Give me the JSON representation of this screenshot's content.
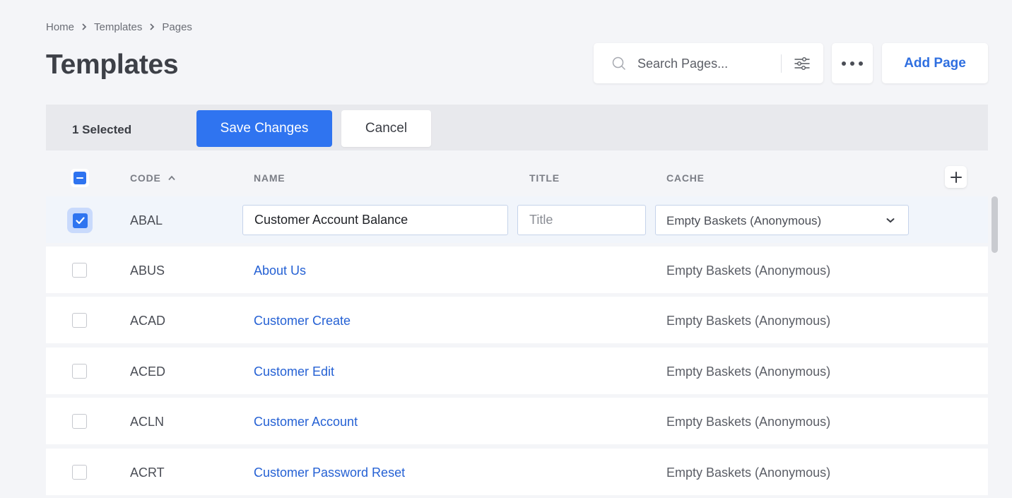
{
  "breadcrumb": [
    "Home",
    "Templates",
    "Pages"
  ],
  "page_title": "Templates",
  "search": {
    "placeholder": "Search Pages..."
  },
  "toolbar": {
    "add_page_label": "Add Page"
  },
  "selection_bar": {
    "count_label": "1 Selected",
    "save_label": "Save Changes",
    "cancel_label": "Cancel"
  },
  "table": {
    "headers": {
      "code": "CODE",
      "name": "NAME",
      "title": "TITLE",
      "cache": "CACHE"
    },
    "editing_row": {
      "code": "ABAL",
      "name_value": "Customer Account Balance",
      "title_placeholder": "Title",
      "cache_value": "Empty Baskets (Anonymous)"
    },
    "rows": [
      {
        "code": "ABUS",
        "name": "About Us",
        "cache": "Empty Baskets (Anonymous)"
      },
      {
        "code": "ACAD",
        "name": "Customer Create",
        "cache": "Empty Baskets (Anonymous)"
      },
      {
        "code": "ACED",
        "name": "Customer Edit",
        "cache": "Empty Baskets (Anonymous)"
      },
      {
        "code": "ACLN",
        "name": "Customer Account",
        "cache": "Empty Baskets (Anonymous)"
      },
      {
        "code": "ACRT",
        "name": "Customer Password Reset",
        "cache": "Empty Baskets (Anonymous)"
      }
    ]
  },
  "colors": {
    "accent": "#2f74f0",
    "link": "#2561d4",
    "background": "#f4f5f8",
    "selection_bar": "#e8e9ed"
  },
  "icons": [
    "chevron-right-icon",
    "search-icon",
    "filter-sliders-icon",
    "more-dots-icon",
    "sort-ascending-icon",
    "plus-icon",
    "checkmark-icon",
    "chevron-down-icon"
  ]
}
